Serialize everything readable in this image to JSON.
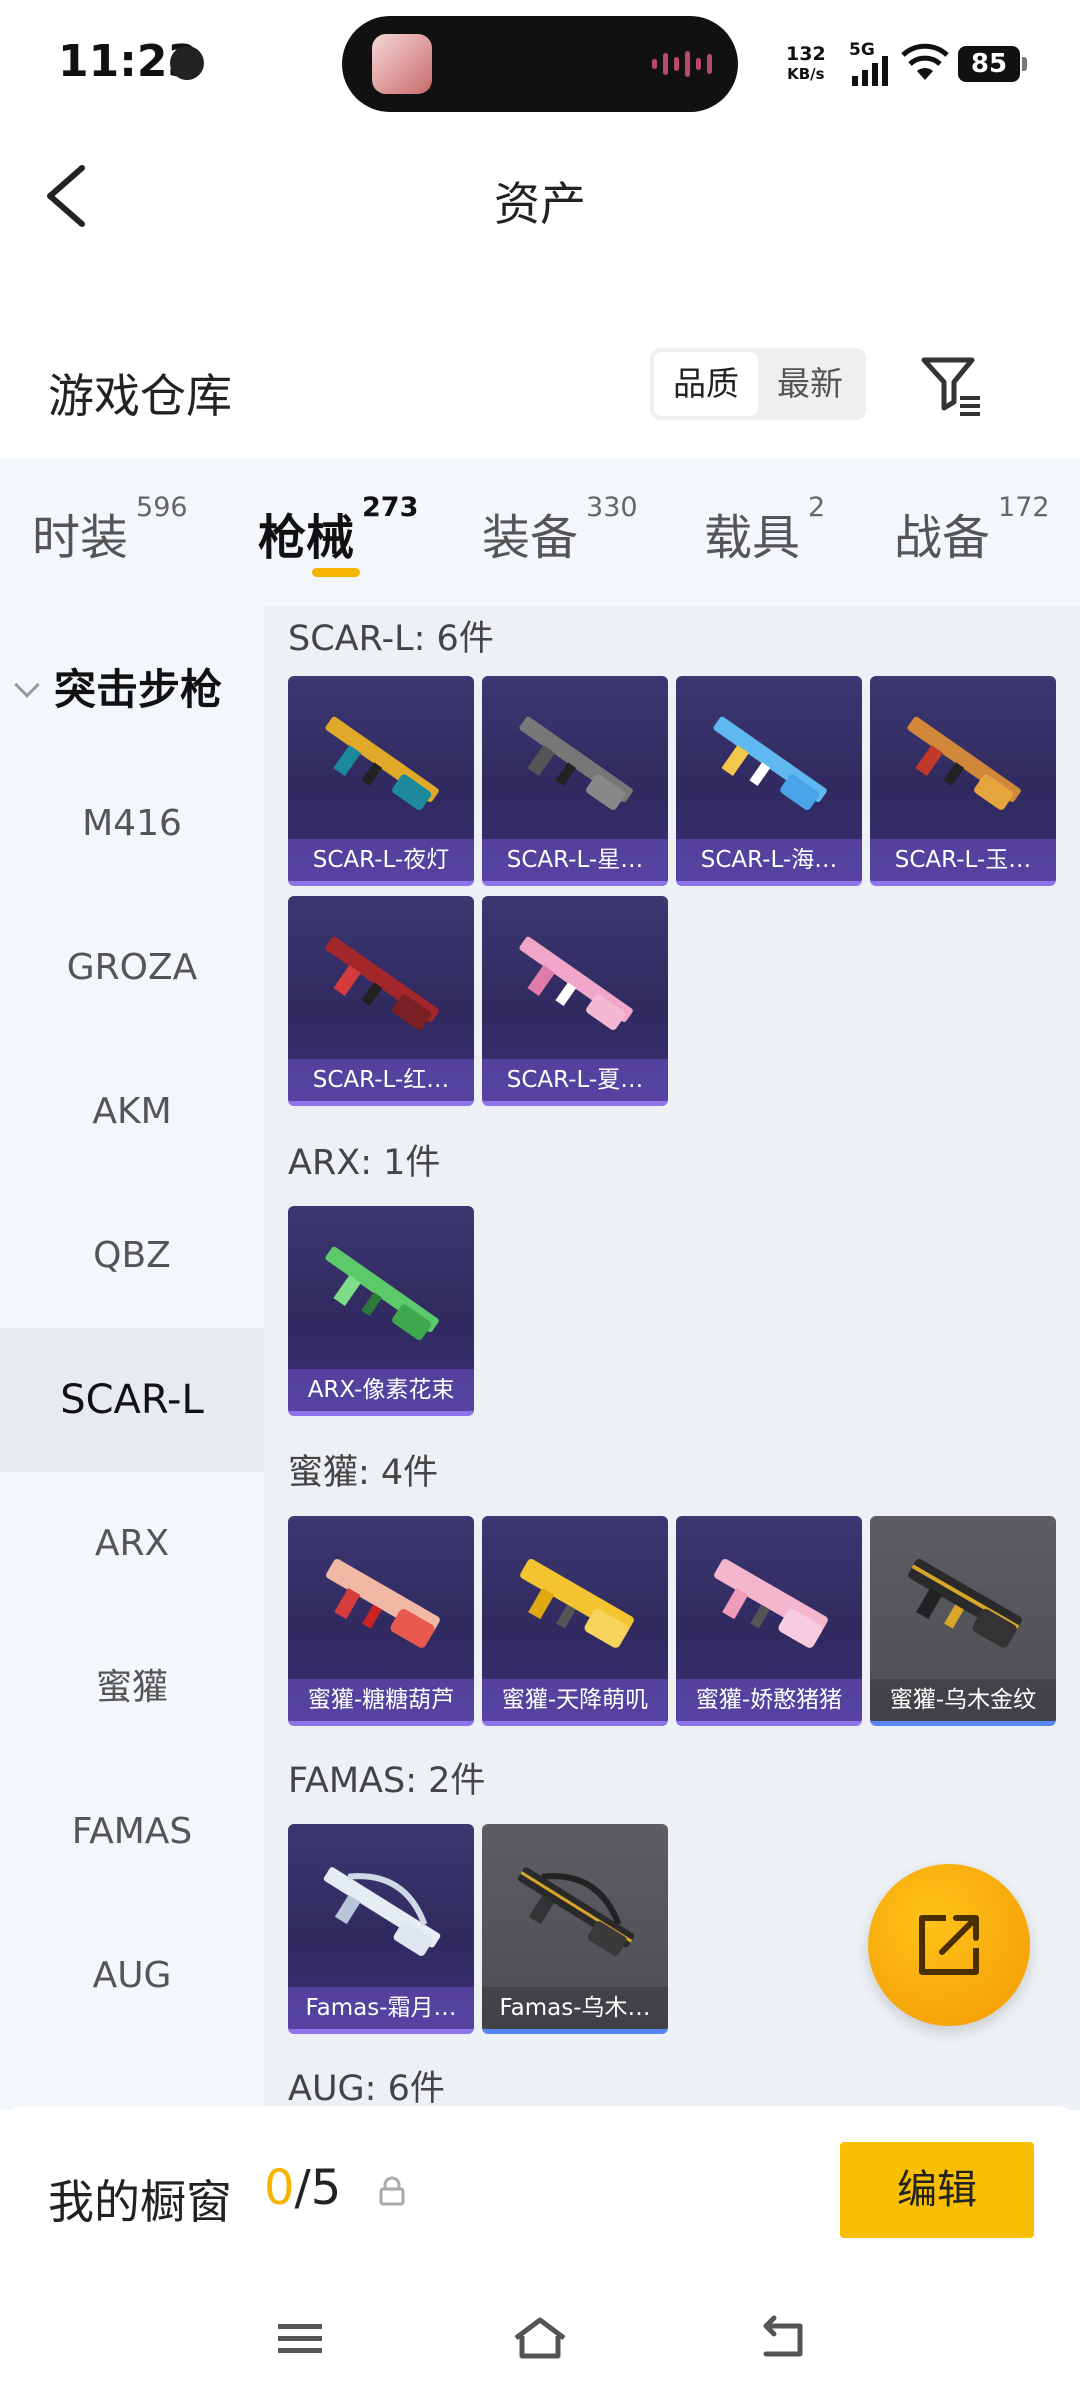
{
  "status_bar": {
    "time": "11:23",
    "net_speed_value": "132",
    "net_speed_unit": "KB/s",
    "network": "5G",
    "battery": "85"
  },
  "header": {
    "title": "资产",
    "back_icon": "chevron-left-icon"
  },
  "warehouse": {
    "title": "游戏仓库",
    "sort_options": [
      "品质",
      "最新"
    ],
    "active_sort": "品质",
    "filter_icon": "filter-icon"
  },
  "tabs": [
    {
      "label": "时装",
      "count": "596"
    },
    {
      "label": "枪械",
      "count": "273"
    },
    {
      "label": "装备",
      "count": "330"
    },
    {
      "label": "载具",
      "count": "2"
    },
    {
      "label": "战备",
      "count": "172"
    }
  ],
  "active_tab": "枪械",
  "sidenav": {
    "category": "突击步枪",
    "items": [
      "M416",
      "GROZA",
      "AKM",
      "QBZ",
      "SCAR-L",
      "ARX",
      "蜜獾",
      "FAMAS",
      "AUG"
    ],
    "active_item": "SCAR-L"
  },
  "sections": [
    {
      "title": "SCAR-L: 6件",
      "cards": [
        "SCAR-L-夜灯",
        "SCAR-L-星…",
        "SCAR-L-海…",
        "SCAR-L-玉…",
        "SCAR-L-红…",
        "SCAR-L-夏…"
      ]
    },
    {
      "title": "ARX: 1件",
      "cards": [
        "ARX-像素花束"
      ]
    },
    {
      "title": "蜜獾: 4件",
      "cards": [
        "蜜獾-糖糖葫芦",
        "蜜獾-天降萌叽",
        "蜜獾-娇憨猪猪",
        "蜜獾-乌木金纹"
      ]
    },
    {
      "title": "FAMAS: 2件",
      "cards": [
        "Famas-霜月…",
        "Famas-乌木…"
      ]
    },
    {
      "title": "AUG: 6件",
      "cards": []
    }
  ],
  "colors": {
    "accent": "#f4b400",
    "card_purple": "#302a60",
    "card_gray": "#4d4d53"
  },
  "showcase": {
    "label": "我的橱窗",
    "current": "0",
    "total": "/5",
    "edit_label": "编辑"
  },
  "fab_icon": "share-export-icon",
  "system_nav": [
    "menu-icon",
    "home-icon",
    "back-icon"
  ]
}
